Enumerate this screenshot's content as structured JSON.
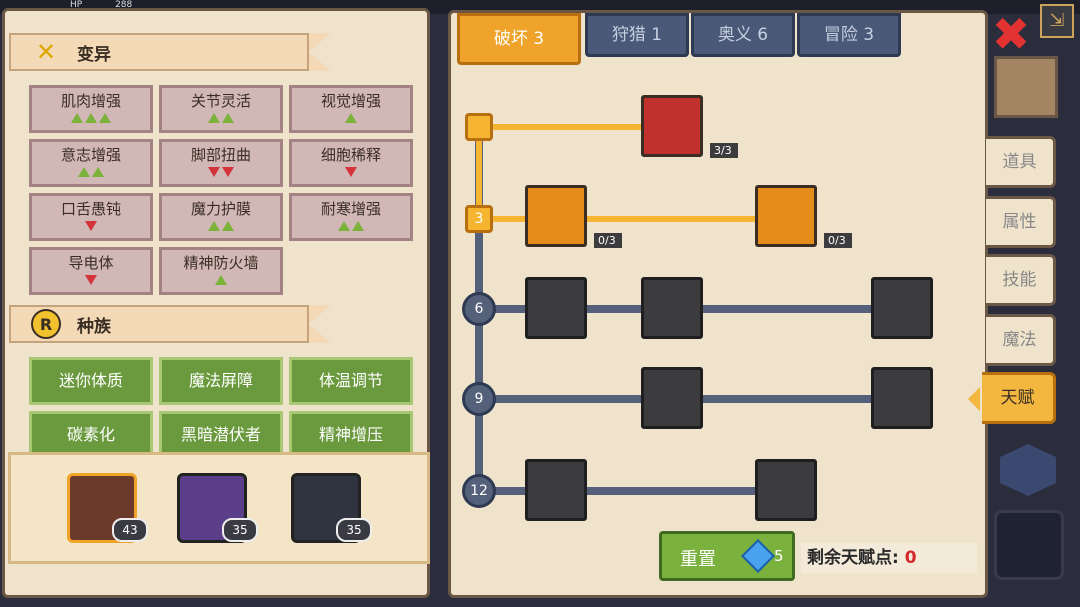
{
  "hud": {
    "hp_label": "HP",
    "hp_value": "288"
  },
  "mutation": {
    "title": "变异",
    "items": [
      {
        "label": "肌肉增强",
        "up": 3,
        "down": 0
      },
      {
        "label": "关节灵活",
        "up": 2,
        "down": 0
      },
      {
        "label": "视觉增强",
        "up": 1,
        "down": 0
      },
      {
        "label": "意志增强",
        "up": 2,
        "down": 0
      },
      {
        "label": "脚部扭曲",
        "up": 0,
        "down": 2
      },
      {
        "label": "细胞稀释",
        "up": 0,
        "down": 1
      },
      {
        "label": "口舌愚钝",
        "up": 0,
        "down": 1
      },
      {
        "label": "魔力护膜",
        "up": 2,
        "down": 0
      },
      {
        "label": "耐寒增强",
        "up": 2,
        "down": 0
      },
      {
        "label": "导电体",
        "up": 0,
        "down": 1
      },
      {
        "label": "精神防火墙",
        "up": 1,
        "down": 0
      }
    ]
  },
  "race": {
    "title": "种族",
    "icon_letter": "R",
    "items": [
      "迷你体质",
      "魔法屏障",
      "体温调节",
      "碳素化",
      "黑暗潜伏者",
      "精神增压"
    ]
  },
  "party": [
    {
      "name": "hero-1",
      "level": "43"
    },
    {
      "name": "hero-2",
      "level": "35"
    },
    {
      "name": "hero-3",
      "level": "35"
    }
  ],
  "talent_tabs": [
    {
      "label": "破坏 3",
      "active": true
    },
    {
      "label": "狩猎 1",
      "active": false
    },
    {
      "label": "奥义 6",
      "active": false
    },
    {
      "label": "冒险 3",
      "active": false
    }
  ],
  "tiers": [
    "3",
    "6",
    "9",
    "12"
  ],
  "nodes": {
    "arm_wrestle": "3/3",
    "muscle": "0/3",
    "arrow": "0/3"
  },
  "reset": {
    "label": "重置",
    "cost": "5"
  },
  "points": {
    "label": "剩余天赋点:",
    "value": "0"
  },
  "side_tabs": [
    "道具",
    "属性",
    "技能",
    "魔法",
    "天赋"
  ],
  "colors": {
    "accent": "#f0a32a",
    "locked": "#3c3c3f",
    "race_green": "#6a9a3d",
    "mutation_bg": "#d1b7b5"
  }
}
